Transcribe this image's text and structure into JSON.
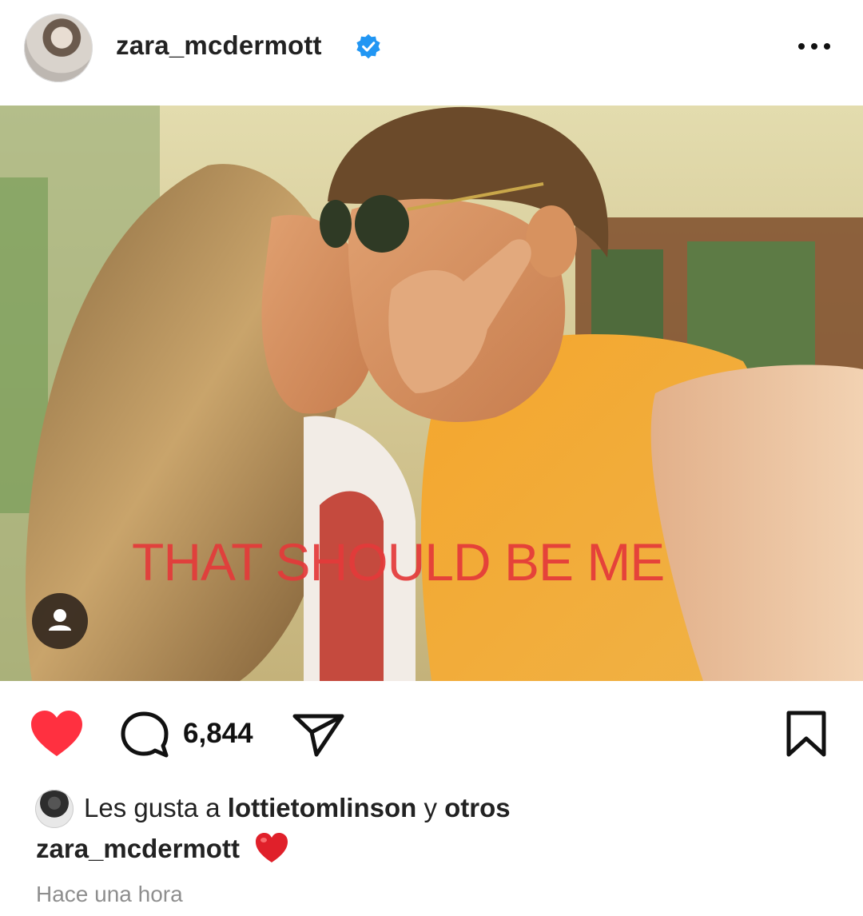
{
  "post": {
    "username": "zara_mcdermott",
    "verified": true,
    "more_icon": "more-horizontal-icon"
  },
  "image": {
    "overlay_text": "THAT SHOULD BE ME",
    "overlay_color": "#e43a3a",
    "tag_icon": "user-tag-icon"
  },
  "actions": {
    "like_icon": "heart-filled-icon",
    "like_color": "#ff3040",
    "comment_icon": "comment-icon",
    "comment_count": "6,844",
    "share_icon": "send-icon",
    "save_icon": "bookmark-icon"
  },
  "likes": {
    "prefix": "Les gusta a ",
    "liked_by": "lottietomlinson",
    "connector": " y ",
    "others": "otros"
  },
  "caption": {
    "username": "zara_mcdermott",
    "emoji": "❤️"
  },
  "timestamp": "Hace una hora"
}
